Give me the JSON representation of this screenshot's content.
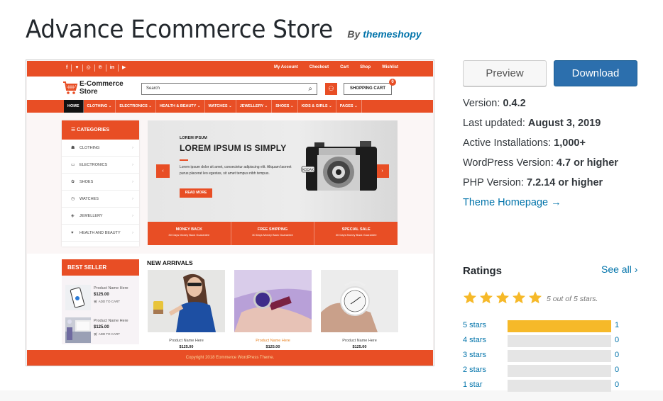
{
  "header": {
    "title": "Advance Ecommerce Store",
    "by_prefix": "By",
    "author": "themeshopy"
  },
  "preview": {
    "social_icons": [
      "facebook-icon",
      "twitter-icon",
      "instagram-icon",
      "pinterest-icon",
      "linkedin-icon",
      "youtube-icon"
    ],
    "social_glyphs": [
      "f",
      "♥",
      "◎",
      "℗",
      "in",
      "▶"
    ],
    "top_links": [
      "My Account",
      "Checkout",
      "Cart",
      "Shop",
      "Wishlist"
    ],
    "logo": {
      "line1": "E-Commerce",
      "line2": "Store"
    },
    "search_placeholder": "Search",
    "shopping_cart_label": "SHOPPING CART",
    "cart_count": "0",
    "nav": [
      {
        "label": "HOME",
        "active": true
      },
      {
        "label": "CLOTHING ⌄"
      },
      {
        "label": "ELECTRONICS ⌄"
      },
      {
        "label": "HEALTH & BEAUTY ⌄"
      },
      {
        "label": "WATCHES ⌄"
      },
      {
        "label": "JEWELLERY ⌄"
      },
      {
        "label": "SHOES ⌄"
      },
      {
        "label": "KIDS & GIRLS ⌄"
      },
      {
        "label": "PAGES ⌄"
      }
    ],
    "categories": {
      "heading": "CATEGORIES",
      "items": [
        {
          "label": "CLOTHING",
          "glyph": "☗"
        },
        {
          "label": "ELECTRONICS",
          "glyph": "▭"
        },
        {
          "label": "SHOES",
          "glyph": "✿"
        },
        {
          "label": "WATCHES",
          "glyph": "◷"
        },
        {
          "label": "JEWELLERY",
          "glyph": "◈"
        },
        {
          "label": "HEALTH AND BEAUTY",
          "glyph": "♥"
        }
      ]
    },
    "slider": {
      "kicker": "LOREM IPSUM",
      "heading": "LOREM IPSUM IS SIMPLY",
      "body": "Lorem ipsum dolor sit amet, consectetur adipiscing elit. Aliquam laoreet purus placerat leo egestas, sit amet tempus nibh tempus.",
      "button": "READ MORE",
      "prev": "‹",
      "next": "›",
      "camera_brand": "KODAK"
    },
    "features": [
      {
        "title": "MONEY BACK",
        "sub": "30 Days Money Back Guarantee"
      },
      {
        "title": "FREE SHIPPING",
        "sub": "30 Days Money Back Guarantee"
      },
      {
        "title": "SPECIAL SALE",
        "sub": "30 Days Money Back Guarantee"
      }
    ],
    "best_seller": {
      "heading": "BEST SELLER",
      "items": [
        {
          "name": "Product Name Here",
          "price": "$125.00",
          "cta": "ADD TO CART"
        },
        {
          "name": "Product Name Here",
          "price": "$125.00",
          "cta": "ADD TO CART"
        }
      ]
    },
    "new_arrivals": {
      "heading": "NEW ARRIVALS",
      "items": [
        {
          "name": "Product Name Here",
          "price": "$125.00"
        },
        {
          "name": "Product Name Here",
          "price": "$125.00"
        },
        {
          "name": "Product Name Here",
          "price": "$125.00"
        }
      ]
    },
    "footer": "Copyright 2018 Eommerce WordPress Theme."
  },
  "actions": {
    "preview": "Preview",
    "download": "Download"
  },
  "meta": {
    "version_label": "Version:",
    "version": "0.4.2",
    "updated_label": "Last updated:",
    "updated": "August 3, 2019",
    "installs_label": "Active Installations:",
    "installs": "1,000+",
    "wp_label": "WordPress Version:",
    "wp": "4.7 or higher",
    "php_label": "PHP Version:",
    "php": "7.2.14 or higher",
    "homepage": "Theme Homepage →"
  },
  "ratings": {
    "title": "Ratings",
    "see_all": "See all ›",
    "stars": 5,
    "summary": "5 out of 5 stars.",
    "breakdown": [
      {
        "label": "5 stars",
        "count": "1",
        "fraction": 1
      },
      {
        "label": "4 stars",
        "count": "0",
        "fraction": 0
      },
      {
        "label": "3 stars",
        "count": "0",
        "fraction": 0
      },
      {
        "label": "2 stars",
        "count": "0",
        "fraction": 0
      },
      {
        "label": "1 star",
        "count": "0",
        "fraction": 0
      }
    ]
  },
  "colors": {
    "accent": "#e84e25",
    "link": "#0073aa",
    "download": "#2c6fad",
    "star": "#f6b929",
    "bar_empty": "#e5e5e5"
  }
}
